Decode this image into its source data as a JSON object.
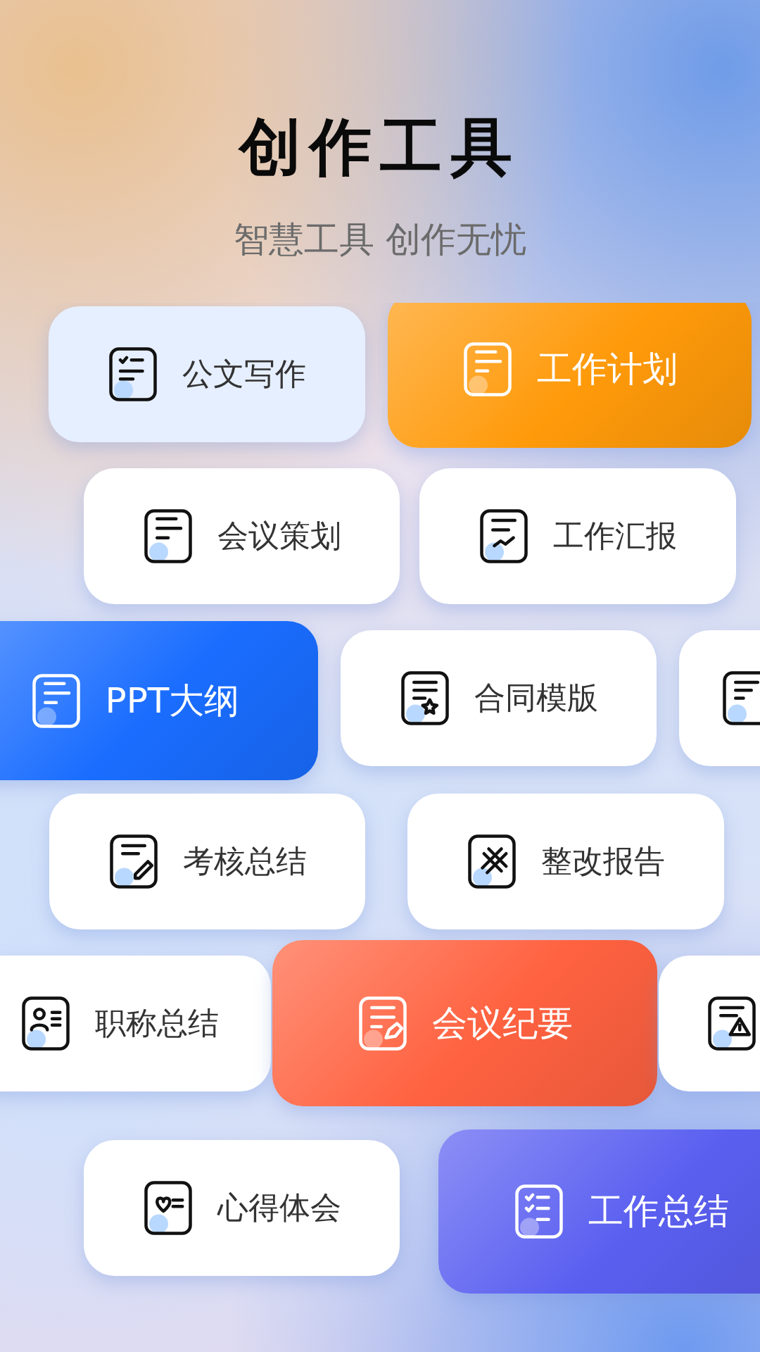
{
  "header": {
    "title": "创作工具",
    "subtitle": "智慧工具 创作无忧"
  },
  "cards": [
    {
      "label": "公文写作",
      "kind": "plain"
    },
    {
      "label": "工作计划",
      "kind": "featured",
      "color": "#ff9a0a"
    },
    {
      "label": "会议策划",
      "kind": "plain"
    },
    {
      "label": "工作汇报",
      "kind": "plain"
    },
    {
      "label": "PPT大纲",
      "kind": "featured",
      "color": "#1a6dff"
    },
    {
      "label": "合同模版",
      "kind": "plain"
    },
    {
      "kind": "plain"
    },
    {
      "label": "考核总结",
      "kind": "plain"
    },
    {
      "label": "整改报告",
      "kind": "plain"
    },
    {
      "label": "职称总结",
      "kind": "plain"
    },
    {
      "label": "会议纪要",
      "kind": "featured",
      "color": "#ff6240"
    },
    {
      "kind": "plain"
    },
    {
      "label": "心得体会",
      "kind": "plain"
    },
    {
      "label": "工作总结",
      "kind": "featured",
      "color": "#5a5ff0"
    }
  ]
}
